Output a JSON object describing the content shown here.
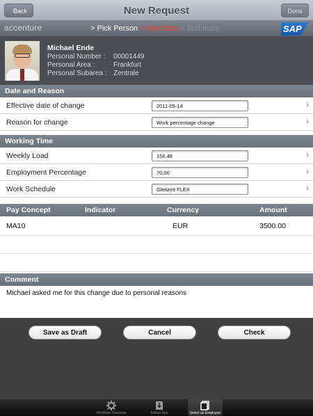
{
  "navbar": {
    "title": "New Request",
    "back_label": "Back",
    "done_label": "Done"
  },
  "stepbar": {
    "brand": "accenture",
    "step_prev": "> Pick Person",
    "step_active": "> Key Data",
    "step_next": "> Summary",
    "sap": "SAP"
  },
  "person": {
    "name": "Michael Ende",
    "fields": [
      {
        "label": "Personal Number :",
        "value": "00001449"
      },
      {
        "label": "Personal Area :",
        "value": "Frankfurt"
      },
      {
        "label": "Personal Subarea :",
        "value": "Zentrale"
      }
    ]
  },
  "sections": {
    "date_reason": "Date and Reason",
    "working_time": "Working Time",
    "comment": "Comment"
  },
  "date_reason": {
    "effective_label": "Effective date of change",
    "effective_value": "2011-05-14",
    "reason_label": "Reason for change",
    "reason_value": "Work percentage change"
  },
  "working_time": {
    "weekly_label": "Weekly Load",
    "weekly_value": "156.48",
    "employment_label": "Employment Percentage",
    "employment_value": "70.00",
    "schedule_label": "Work Schedule",
    "schedule_value": "Gleitzeit FLEX"
  },
  "pay_table": {
    "headers": [
      "Pay Concept",
      "Indicator",
      "Currency",
      "Amount"
    ],
    "rows": [
      {
        "pay_concept": "MA10",
        "indicator": "",
        "currency": "EUR",
        "amount": "3500.00"
      }
    ]
  },
  "comment_text": "Michael asked me for this change due to personal reasons",
  "actions": {
    "save_draft": "Save as Draft",
    "cancel": "Cancel",
    "check": "Check"
  },
  "tabbar": {
    "tabs": [
      {
        "label": "Workflow Overview",
        "icon": "gear-icon"
      },
      {
        "label": "Follow-Ups",
        "icon": "download-icon"
      },
      {
        "label": "Select an Employee",
        "icon": "document-icon"
      }
    ],
    "active_index": 2
  }
}
